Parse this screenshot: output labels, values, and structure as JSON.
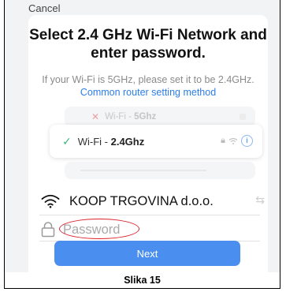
{
  "header": {
    "cancel_label": "Cancel"
  },
  "dialog": {
    "title": "Select 2.4 GHz Wi-Fi Network and enter password.",
    "subtitle": "If your Wi-Fi is 5GHz, please set it to be 2.4GHz.",
    "link_text": "Common router setting method"
  },
  "illustration": {
    "faded_prefix": "Wi-Fi - ",
    "faded_band": "5Ghz",
    "main_prefix": "Wi-Fi - ",
    "main_band": "2.4Ghz"
  },
  "form": {
    "ssid": "KOOP TRGOVINA d.o.o.",
    "password_placeholder": "Password",
    "next_label": "Next"
  },
  "caption": "Slika 15",
  "colors": {
    "accent": "#4a8ff0",
    "link": "#2d7de8",
    "highlight": "#d9232e",
    "check": "#3bb67c"
  }
}
